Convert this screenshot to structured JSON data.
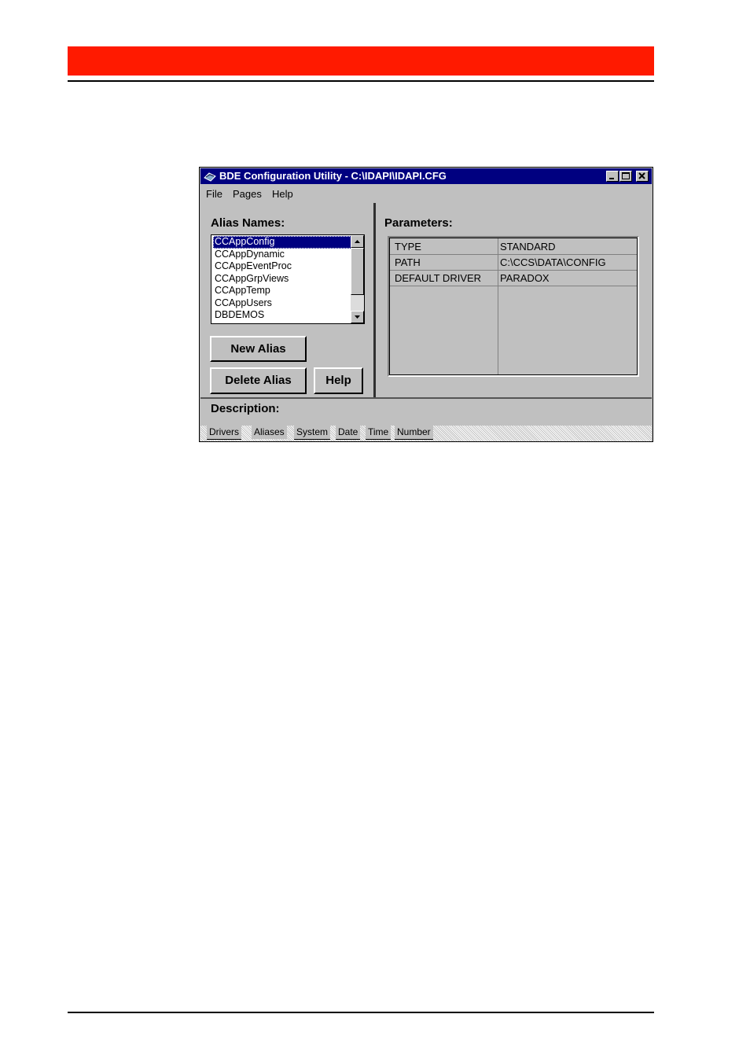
{
  "window": {
    "title": "BDE Configuration Utility - C:\\IDAPI\\IDAPI.CFG",
    "menu": [
      "File",
      "Pages",
      "Help"
    ]
  },
  "left_pane": {
    "alias_names_label": "Alias Names:",
    "aliases": [
      "CCAppConfig",
      "CCAppDynamic",
      "CCAppEventProc",
      "CCAppGrpViews",
      "CCAppTemp",
      "CCAppUsers",
      "DBDEMOS"
    ],
    "selected_alias": "CCAppConfig",
    "buttons": {
      "new_alias": "New Alias",
      "delete_alias": "Delete Alias",
      "help": "Help"
    }
  },
  "right_pane": {
    "parameters_label": "Parameters:",
    "parameters": [
      {
        "key": "TYPE",
        "value": "STANDARD"
      },
      {
        "key": "PATH",
        "value": "C:\\CCS\\DATA\\CONFIG"
      },
      {
        "key": "DEFAULT DRIVER",
        "value": "PARADOX"
      }
    ]
  },
  "description_label": "Description:",
  "tabs": [
    "Drivers",
    "Aliases",
    "System",
    "Date",
    "Time",
    "Number"
  ],
  "active_tab": "Aliases",
  "colors": {
    "header_bar": "#ff1a00",
    "titlebar": "#000080",
    "face": "#c0c0c0"
  }
}
